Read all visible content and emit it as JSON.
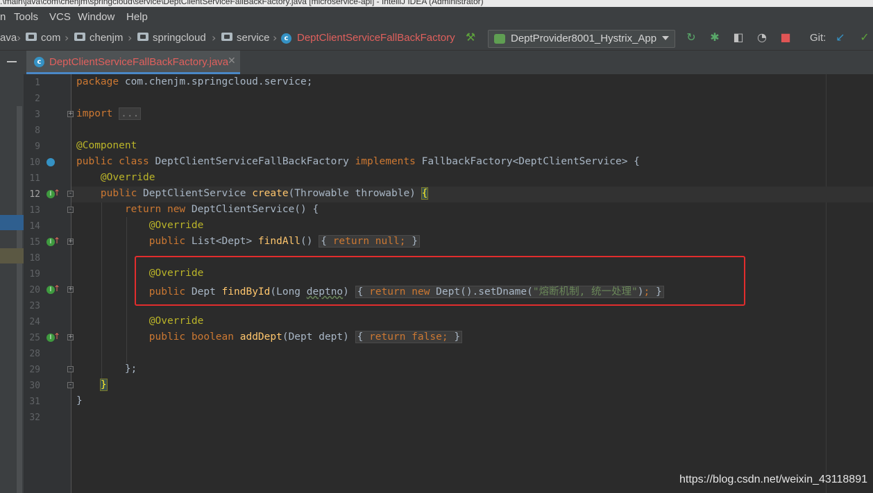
{
  "window": {
    "title": ".\\main\\java\\com\\chenjm\\springcloud\\service\\DeptClientServiceFallBackFactory.java [microservice-api] - IntelliJ IDEA (Administrator)"
  },
  "menu": [
    "n",
    "Tools",
    "VCS",
    "Window",
    "Help"
  ],
  "breadcrumbs": [
    "ava",
    "com",
    "chenjm",
    "springcloud",
    "service",
    "DeptClientServiceFallBackFactory"
  ],
  "toolbar": {
    "run_config": "DeptProvider8001_Hystrix_App",
    "git_label": "Git:"
  },
  "tab": {
    "file_name": "DeptClientServiceFallBackFactory.java",
    "icon_letter": "c"
  },
  "code": {
    "lines": {
      "l1": "1",
      "l2": "2",
      "l3": "3",
      "l8": "8",
      "l9": "9",
      "l10": "10",
      "l11": "11",
      "l12": "12",
      "l13": "13",
      "l14": "14",
      "l15": "15",
      "l18": "18",
      "l19": "19",
      "l20": "20",
      "l23": "23",
      "l24": "24",
      "l25": "25",
      "l28": "28",
      "l29": "29",
      "l30": "30",
      "l31": "31",
      "l32": "32"
    },
    "package_kw": "package",
    "package_name": "com.chenjm.springcloud.service;",
    "import_kw": "import",
    "import_fold": "...",
    "ann_component": "@Component",
    "class_decl_kw1": "public class",
    "class_name": " DeptClientServiceFallBackFactory ",
    "implements_kw": "implements",
    "class_decl_rest": " FallbackFactory<DeptClientService> {",
    "ann_override": "@Override",
    "public_kw": "public",
    "create_type": " DeptClientService ",
    "create_fn": "create",
    "create_params": "(Throwable throwable) ",
    "open_brace": "{",
    "return_kw": "return",
    "new_kw": "new",
    "anon_rest": " DeptClientService() {",
    "findall_type": " List<Dept> ",
    "findall_fn": "findAll",
    "findall_parens": "()",
    "findall_body_kw": "return null",
    "semicolon": ";",
    "close_brace": "}",
    "open_brace2": "{",
    "findbyid_type": " Dept ",
    "findbyid_fn": "findById",
    "findbyid_param_open": "(Long ",
    "findbyid_param": "deptno",
    "findbyid_param_close": ")",
    "findbyid_body_rest": " Dept().setDname(",
    "findbyid_str": "\"熔断机制, 统一处理\"",
    "findbyid_body_end": ")",
    "adddept_boolean": "boolean",
    "adddept_fn": "addDept",
    "adddept_params": "(Dept dept)",
    "adddept_body": "return false",
    "anon_close": "};",
    "method_close": "}",
    "class_close": "}"
  },
  "watermark": "https://blog.csdn.net/weixin_43118891"
}
